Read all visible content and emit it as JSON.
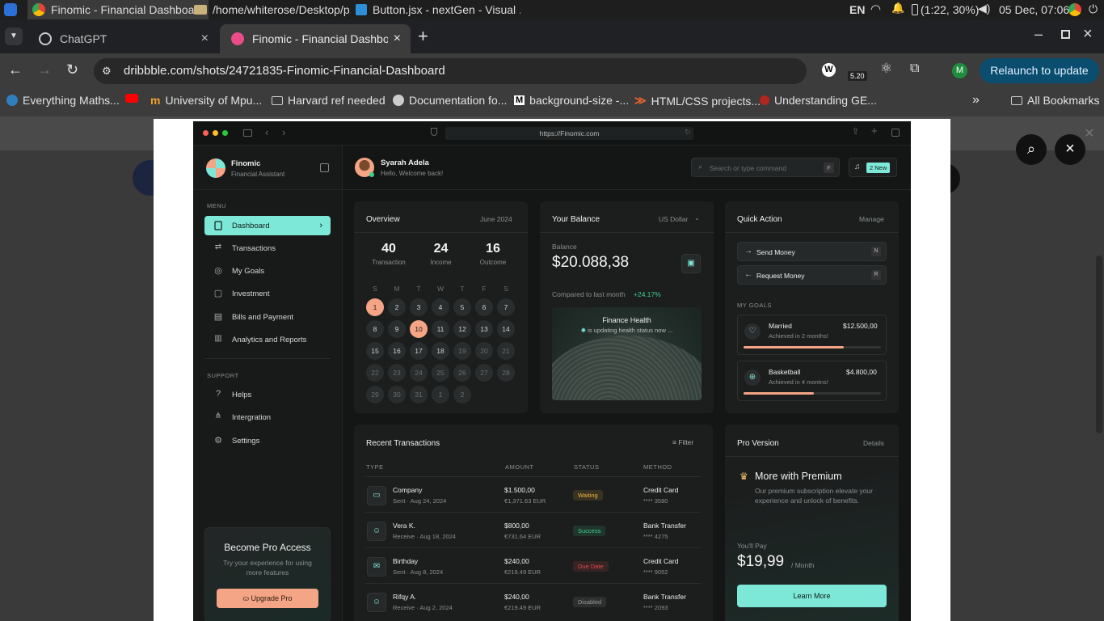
{
  "system": {
    "tabs": [
      "Finomic - Financial Dashboa...",
      "/home/whiterose/Desktop/p...",
      "Button.jsx - nextGen - Visual ..."
    ],
    "lang": "EN",
    "battery": "(1:22, 30%)",
    "datetime": "05 Dec, 07:06"
  },
  "browser": {
    "tabs": [
      "ChatGPT",
      "Finomic - Financial Dashboard"
    ],
    "url": "dribbble.com/shots/24721835-Finomic-Financial-Dashboard",
    "ext_badge": "5.20",
    "profile": "M",
    "relaunch": "Relaunch to update",
    "bookmarks": [
      "Everything Maths...",
      "University of Mpu...",
      "Harvard ref needed",
      "Documentation fo...",
      "background-size -...",
      "HTML/CSS projects...",
      "Understanding GE..."
    ],
    "all_bookmarks": "All Bookmarks"
  },
  "mock_browser": {
    "url": "https://Finomic.com"
  },
  "sidebar": {
    "brand": "Finomic",
    "subtitle": "Financial Assistant",
    "menu_heading": "MENU",
    "menu": [
      "Dashboard",
      "Transactions",
      "My Goals",
      "Investment",
      "Bills and Payment",
      "Analytics and Reports"
    ],
    "support_heading": "SUPPORT",
    "support": [
      "Helps",
      "Intergration",
      "Settings"
    ],
    "pro_title": "Become Pro Access",
    "pro_text": "Try your experience for using more features",
    "pro_button": "Upgrade Pro"
  },
  "header": {
    "user": "Syarah Adela",
    "greeting": "Hello, Welcome back!",
    "search_placeholder": "Search or type command",
    "search_key": "F",
    "notif": "2 New"
  },
  "overview": {
    "title": "Overview",
    "period": "June 2024",
    "stats": [
      {
        "value": "40",
        "label": "Transaction"
      },
      {
        "value": "24",
        "label": "Income"
      },
      {
        "value": "16",
        "label": "Outcome"
      }
    ],
    "weekdays": [
      "S",
      "M",
      "T",
      "W",
      "T",
      "F",
      "S"
    ],
    "days": [
      "1",
      "2",
      "3",
      "4",
      "5",
      "6",
      "7",
      "8",
      "9",
      "10",
      "11",
      "12",
      "13",
      "14",
      "15",
      "16",
      "17",
      "18",
      "19",
      "20",
      "21",
      "22",
      "23",
      "24",
      "25",
      "26",
      "27",
      "28",
      "29",
      "30",
      "31",
      "1",
      "2"
    ],
    "highlighted": [
      "1",
      "10"
    ]
  },
  "balance": {
    "title": "Your Balance",
    "currency": "US Dollar",
    "label": "Balance",
    "amount": "$20.088,38",
    "compare": "Compared to last month",
    "change": "+24.17%",
    "health_title": "Finance Health",
    "health_status": "is updating health status now ..."
  },
  "quick": {
    "title": "Quick Action",
    "manage": "Manage",
    "actions": [
      {
        "label": "Send Money",
        "key": "N"
      },
      {
        "label": "Request Money",
        "key": "R"
      }
    ],
    "goals_heading": "MY GOALS",
    "goals": [
      {
        "name": "Married",
        "amount": "$12.500,00",
        "note": "Achieved in 2 months!",
        "progress": 0.73
      },
      {
        "name": "Basketball",
        "amount": "$4.800,00",
        "note": "Achieved in 4 montns!",
        "progress": 0.51
      }
    ]
  },
  "transactions": {
    "title": "Recent Transactions",
    "filter": "Filter",
    "columns": [
      "TYPE",
      "AMOUNT",
      "STATUS",
      "METHOD"
    ],
    "rows": [
      {
        "name": "Company",
        "sub": "Sent · Aug 24, 2024",
        "amount": "$1.500,00",
        "eur": "€1,371.63 EUR",
        "status": "Waiting",
        "method": "Credit Card",
        "card": "**** 3580"
      },
      {
        "name": "Vera K.",
        "sub": "Receive · Aug 18, 2024",
        "amount": "$800,00",
        "eur": "€731.64 EUR",
        "status": "Success",
        "method": "Bank Transfer",
        "card": "**** 4275"
      },
      {
        "name": "Birthday",
        "sub": "Sent · Aug 8, 2024",
        "amount": "$240,00",
        "eur": "€219.49 EUR",
        "status": "Due Date",
        "method": "Credit Card",
        "card": "**** 9052"
      },
      {
        "name": "Rifqy A.",
        "sub": "Receive · Aug 2, 2024",
        "amount": "$240,00",
        "eur": "€219.49 EUR",
        "status": "Disabled",
        "method": "Bank Transfer",
        "card": "**** 2093"
      }
    ],
    "status_colors": {
      "Waiting": "#f0b43c",
      "Success": "#3ccf8e",
      "Due Date": "#e8484a",
      "Disabled": "#9a9a9a"
    }
  },
  "pro": {
    "title": "Pro Version",
    "details": "Details",
    "heading": "More with Premium",
    "text": "Our premium subscription elevate your experience and unlock of benefits.",
    "pay_label": "You'll Pay",
    "price": "$19,99",
    "per": "/ Month",
    "button": "Learn More"
  },
  "colors": {
    "accent": "#7ee8d8",
    "peach": "#f3a585",
    "positive": "#3ccf8e"
  }
}
